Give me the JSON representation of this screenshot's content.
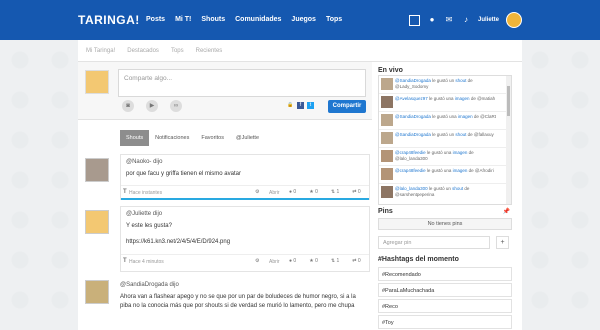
{
  "topbar": {
    "logo": "TARINGA!",
    "nav": [
      "Posts",
      "Mi T!",
      "Shouts",
      "Comunidades",
      "Juegos",
      "Tops"
    ],
    "username": "Juliette"
  },
  "subnav": [
    "Mi Taringa!",
    "Destacados",
    "Tops",
    "Recientes"
  ],
  "composer": {
    "placeholder": "Comparte algo...",
    "share_button": "Compartir"
  },
  "tabs": [
    "Shouts",
    "Notificaciones",
    "Favoritos",
    "@Juliette"
  ],
  "posts": [
    {
      "author": "@Naoko- dijo",
      "text": "por que facu y griffa tienen el mismo avatar",
      "time": "Hace instantes",
      "open": "Abrir",
      "comments": "0",
      "favs": "0",
      "reshares": "1",
      "likes": "0"
    },
    {
      "author": "@Juliette dijo",
      "text1": "Y este les gusta?",
      "text2": "https://k61.kn3.net/2/4/5/4/E/D/924.png",
      "time": "Hace 4 minutos",
      "open": "Abrir",
      "comments": "0",
      "favs": "0",
      "reshares": "1",
      "likes": "0"
    },
    {
      "author": "@SandiaDrogada dijo",
      "text": "Ahora van a flashear apego y no se que por un par de boludeces de humor negro, si a la piba no la conocia más que por shouts si de verdad se murió lo lamento, pero me chupa"
    }
  ],
  "live": {
    "title": "En vivo",
    "items": [
      {
        "user": "@SandiaDrogada",
        "mid": " le gustó un ",
        "what": "shout",
        "to": " de @Lady_Sodomy"
      },
      {
        "user": "@Avelasquez97",
        "mid": " le gustó una ",
        "what": "imagen",
        "to": " de @matiah"
      },
      {
        "user": "@SandiaDrogada",
        "mid": " le gustó una ",
        "what": "imagen",
        "to": " de @ClaRt"
      },
      {
        "user": "@SandiaDrogada",
        "mid": " le gustó un ",
        "what": "shout",
        "to": " de @fallaxuy"
      },
      {
        "user": "@crap48feedie",
        "mid": " le gustó una ",
        "what": "imagen",
        "to": " de @lalo_landa300"
      },
      {
        "user": "@crap48feedie",
        "mid": " le gustó una ",
        "what": "imagen",
        "to": " de @Afrodiri"
      },
      {
        "user": "@lalo_landa300",
        "mid": " le gustó un ",
        "what": "shout",
        "to": " de @sarshentpeperina"
      }
    ]
  },
  "pins": {
    "title": "Pins",
    "empty": "No tienes pins",
    "add_placeholder": "Agregar pin",
    "add_button": "+"
  },
  "hashtags": {
    "title": "#Hashtags del momento",
    "items": [
      "#Recomendado",
      "#ParaLaMuchachada",
      "#Reco",
      "#Toy"
    ]
  }
}
